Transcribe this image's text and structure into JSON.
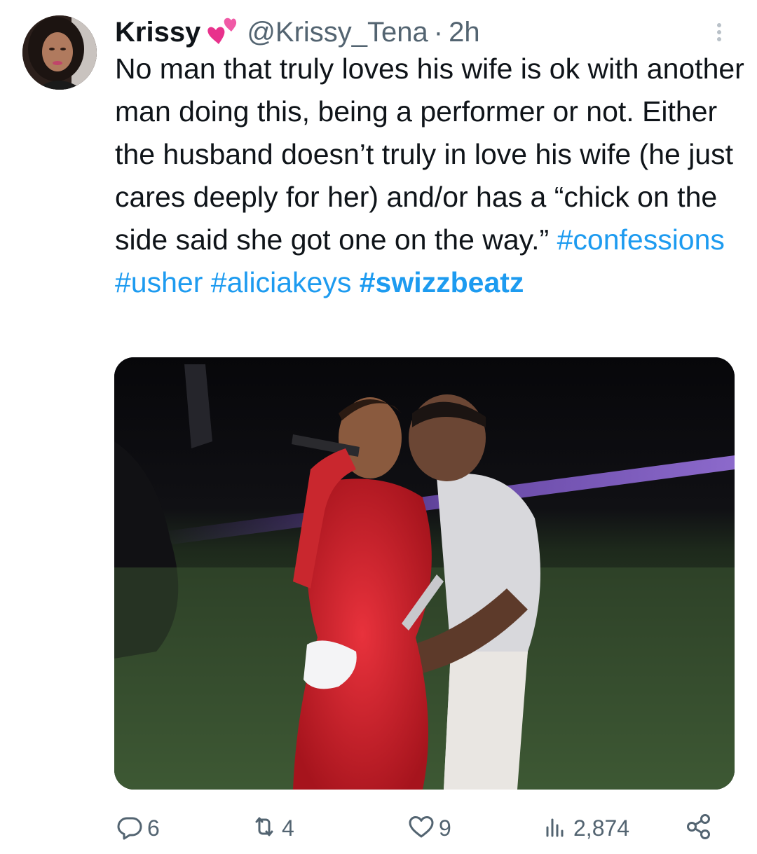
{
  "tweet": {
    "author_name": "Krissy",
    "author_emoji": "💕",
    "handle": "@Krissy_Tena",
    "separator": "·",
    "time": "2h",
    "text": "No man that truly loves his wife is ok with another man doing this, being a performer or not. Either the husband doesn’t truly in love his wife (he just cares deeply for her) and/or has a “chick on the side said she got one on the way.”",
    "hashtags": [
      "#confessions",
      "#usher",
      "#aliciakeys",
      "#swizzbeatz"
    ]
  },
  "actions": {
    "replies": "6",
    "reposts": "4",
    "likes": "9",
    "views": "2,874"
  },
  "icons": {
    "reply": "reply-icon",
    "repost": "repost-icon",
    "like": "heart-icon",
    "views": "views-icon",
    "share": "share-icon",
    "more": "more-vertical-icon"
  },
  "colors": {
    "link": "#1d9bf0",
    "secondary_text": "#536471",
    "primary_text": "#0f1419"
  }
}
